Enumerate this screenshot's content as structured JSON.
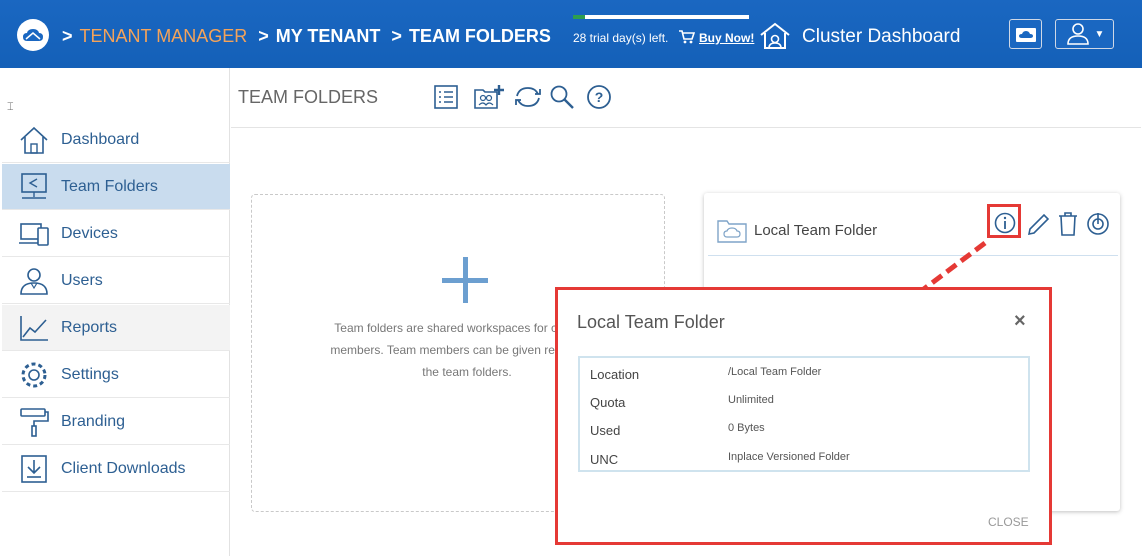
{
  "header": {
    "breadcrumb": [
      {
        "label": "TENANT MANAGER"
      },
      {
        "label": "MY TENANT"
      },
      {
        "label": "TEAM FOLDERS"
      }
    ],
    "breadcrumb_sep": ">",
    "trial_text": "28 trial day(s) left.",
    "trial_progress": 0.07,
    "buy_now": "Buy Now!",
    "cluster_dashboard": "Cluster Dashboard",
    "colors": {
      "bar": "#1565c0",
      "breadcrumb_highlight": "#f4a35a"
    }
  },
  "sidebar": {
    "items": [
      {
        "label": "Dashboard",
        "icon": "home-icon"
      },
      {
        "label": "Team Folders",
        "icon": "shared-folder-icon",
        "active": true
      },
      {
        "label": "Devices",
        "icon": "devices-icon"
      },
      {
        "label": "Users",
        "icon": "user-icon"
      },
      {
        "label": "Reports",
        "icon": "chart-icon"
      },
      {
        "label": "Settings",
        "icon": "gear-icon"
      },
      {
        "label": "Branding",
        "icon": "paint-roller-icon"
      },
      {
        "label": "Client Downloads",
        "icon": "download-icon"
      }
    ]
  },
  "main": {
    "title": "TEAM FOLDERS",
    "add_card_text_1": "Team folders are shared workspaces for collabora",
    "add_card_text_2": "members. Team members can be given read and w",
    "add_card_text_3": "the team folders.",
    "folder_card": {
      "name": "Local Team Folder"
    }
  },
  "dialog": {
    "title": "Local Team Folder",
    "close_glyph": "×",
    "rows": [
      {
        "key": "Location",
        "value": "/Local Team Folder"
      },
      {
        "key": "Quota",
        "value": "Unlimited"
      },
      {
        "key": "Used",
        "value": "0 Bytes"
      },
      {
        "key": "UNC",
        "value": "Inplace Versioned Folder"
      }
    ],
    "close_button": "CLOSE"
  }
}
